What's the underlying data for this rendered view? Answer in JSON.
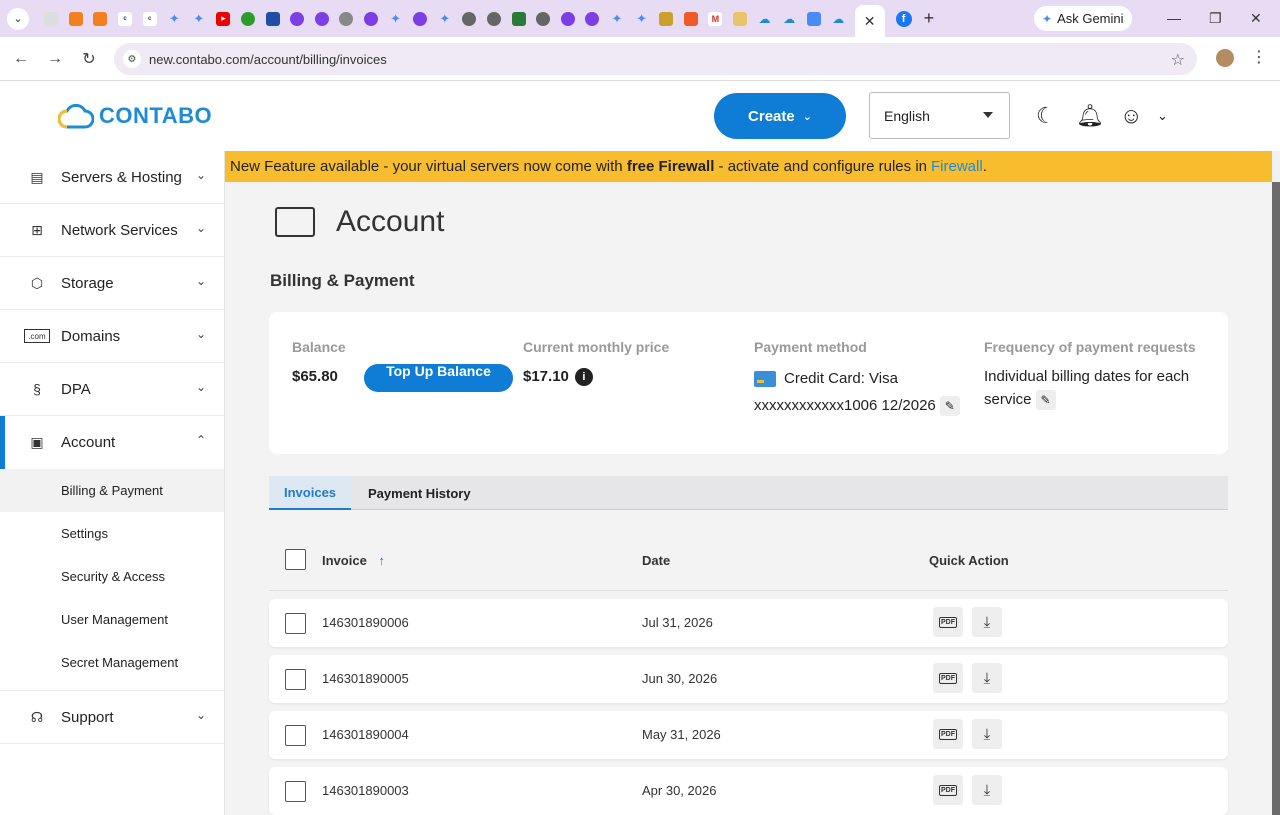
{
  "browser": {
    "tab_icon_colors": [
      "#e8dcf5"
    ],
    "ask_gemini_label": "Ask Gemini",
    "url": "new.contabo.com/account/billing/invoices"
  },
  "header": {
    "logo_text": "CONTABO",
    "create_label": "Create",
    "language": "English"
  },
  "sidebar": {
    "items": [
      {
        "label": "Servers & Hosting",
        "icon": "server-icon"
      },
      {
        "label": "Network Services",
        "icon": "network-icon"
      },
      {
        "label": "Storage",
        "icon": "storage-cube-icon"
      },
      {
        "label": "Domains",
        "icon": "domain-icon"
      },
      {
        "label": "DPA",
        "icon": "document-icon"
      },
      {
        "label": "Account",
        "icon": "account-card-icon"
      },
      {
        "label": "Support",
        "icon": "headset-icon"
      }
    ],
    "account_sub": [
      "Billing & Payment",
      "Settings",
      "Security & Access",
      "User Management",
      "Secret Management"
    ]
  },
  "banner": {
    "text_before": "New Feature available - your virtual servers now come with",
    "bold": "free Firewall",
    "text_after": "- activate and configure rules in",
    "link": "Firewall",
    "end": "."
  },
  "page": {
    "title": "Account",
    "section": "Billing & Payment"
  },
  "billing": {
    "balance_label": "Balance",
    "balance_value": "$65.80",
    "topup_label": "Top Up Balance",
    "price_label": "Current monthly price",
    "price_value": "$17.10",
    "payment_label": "Payment method",
    "payment_line1": "Credit Card: Visa",
    "payment_line2": "xxxxxxxxxxxx1006 12/2026",
    "freq_label": "Frequency of payment requests",
    "freq_value": "Individual billing dates for each service"
  },
  "tabs": [
    "Invoices",
    "Payment History"
  ],
  "table": {
    "columns": [
      "Invoice",
      "Date",
      "Quick Action"
    ],
    "rows": [
      {
        "invoice": "146301890006",
        "date": "Jul 31, 2026"
      },
      {
        "invoice": "146301890005",
        "date": "Jun 30, 2026"
      },
      {
        "invoice": "146301890004",
        "date": "May 31, 2026"
      },
      {
        "invoice": "146301890003",
        "date": "Apr 30, 2026"
      }
    ]
  }
}
